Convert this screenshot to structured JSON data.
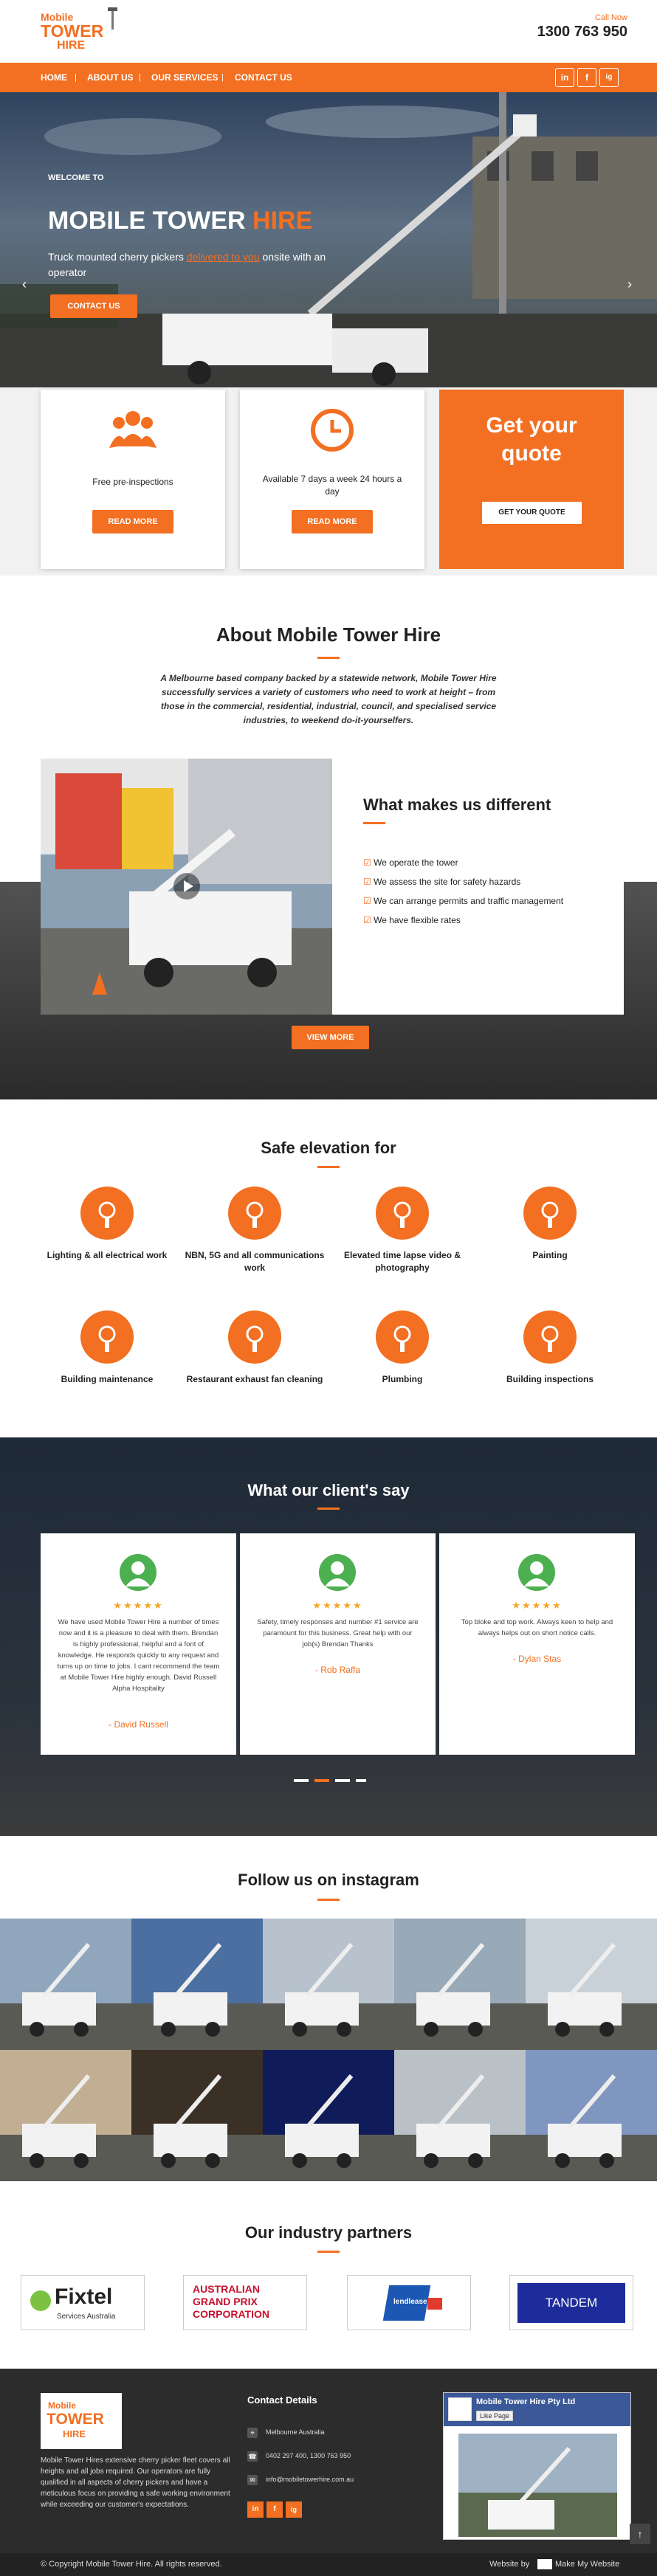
{
  "brand": {
    "logo_top": "Mobile",
    "logo_mid": "TOWER",
    "logo_bot": "HIRE",
    "call_label": "Call Now",
    "phone": "1300 763 950"
  },
  "nav": {
    "items": [
      "HOME",
      "ABOUT US",
      "OUR SERVICES",
      "CONTACT US"
    ],
    "social": [
      "in",
      "f",
      "ig"
    ]
  },
  "hero": {
    "welcome": "WELCOME TO",
    "title_a": "MOBILE TOWER ",
    "title_b": "HIRE",
    "sub_a": "Truck mounted cherry pickers ",
    "sub_link": "delivered to you",
    "sub_b": " onsite with an operator",
    "cta": "CONTACT US"
  },
  "features": [
    {
      "text": "Free pre-inspections",
      "btn": "READ MORE"
    },
    {
      "text": "Available 7 days a week 24 hours a day",
      "btn": "READ MORE"
    }
  ],
  "quote": {
    "title": "Get your quote",
    "btn": "GET YOUR QUOTE"
  },
  "about": {
    "title": "About Mobile Tower Hire",
    "body": "A Melbourne based company backed by a statewide network, Mobile Tower Hire successfully services a variety of customers who need to work at height – from those in the commercial, residential, industrial, council, and specialised service industries, to weekend do-it-yourselfers."
  },
  "different": {
    "title": "What makes us different",
    "items": [
      "We operate the tower",
      "We assess the site for safety hazards",
      "We can arrange permits and traffic management",
      "We have flexible rates"
    ],
    "btn": "VIEW MORE"
  },
  "services": {
    "title": "Safe elevation for",
    "items": [
      "Lighting & all electrical work",
      "NBN, 5G and all communications work",
      "Elevated time lapse video & photography",
      "Painting",
      "Building maintenance",
      "Restaurant exhaust fan cleaning",
      "Plumbing",
      "Building inspections"
    ],
    "icons": [
      "lamp-icon",
      "nbn-icon",
      "camera-icon",
      "paint-icon",
      "house-icon",
      "fan-icon",
      "pipe-icon",
      "building-icon"
    ]
  },
  "testimonials": {
    "title": "What our client's say",
    "stars": "★★★★★",
    "items": [
      {
        "text": "We have used Mobile Tower Hire a number of times now and it is a pleasure to deal with them. Brendan is highly professional, helpful and a font of knowledge. He responds quickly to any request and turns up on time to jobs. I cant recommend the team at Mobile Tower Hire highly enough. David Russell Alpha Hospitality",
        "author": "- David Russell"
      },
      {
        "text": "Safety, timely responses and number #1 service are paramount for this business. Great help with our job(s) Brendan Thanks",
        "author": "- Rob Raffa"
      },
      {
        "text": "Top bloke and top work. Always keen to help and always helps out on short notice calls.",
        "author": "- Dylan Stas"
      }
    ]
  },
  "instagram": {
    "title": "Follow us on instagram"
  },
  "partners": {
    "title": "Our industry partners",
    "items": [
      "Fixtel",
      "AUSTRALIAN GRAND PRIX CORPORATION",
      "lendlease",
      "TANDEM"
    ],
    "fixtel_sub": "Services Australia"
  },
  "footer": {
    "about": "Mobile Tower Hires extensive cherry picker fleet covers all heights and all jobs required. Our operators are fully qualified in all aspects of cherry pickers and have a meticulous focus on providing a safe working environment while exceeding our customer's expectations.",
    "contact_title": "Contact Details",
    "location": "Melbourne Australia",
    "phones": "0402 297 400, 1300 763 950",
    "email": "info@mobiletowerhire.com.au",
    "fb_name": "Mobile Tower Hire Pty Ltd",
    "fb_like": "Like Page",
    "copyright": "© Copyright Mobile Tower Hire. All rights reserved.",
    "credit": "Website by",
    "credit_brand": "Make My Website"
  }
}
